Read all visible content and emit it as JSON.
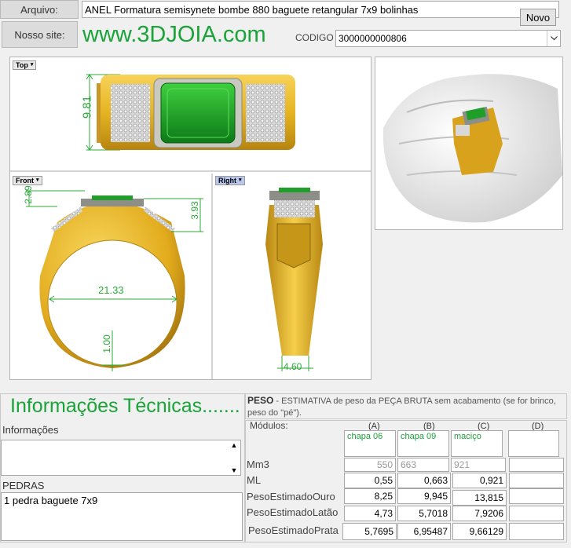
{
  "header": {
    "arquivo_label": "Arquivo:",
    "arquivo_value": "ANEL Formatura semisynete bombe 880 baguete retangular 7x9 bolinhas",
    "novo_button": "Novo",
    "site_label": "Nosso site:",
    "site_url": "www.3DJOIA.com",
    "codigo_label": "CODIGO",
    "codigo_value": "3000000000806"
  },
  "viewports": {
    "top": "Top",
    "front": "Front",
    "right": "Right",
    "dims": {
      "top_width": "9.81",
      "front_height_left": "2.89",
      "front_height_right": "3.93",
      "front_inner": "21.33",
      "front_band": "1.00",
      "right_width": "4.60"
    }
  },
  "info": {
    "title": "Informações Técnicas.......",
    "informacoes_label": "Informações",
    "informacoes_value": "",
    "pedras_label": "PEDRAS",
    "pedras_value": "1 pedra baguete 7x9"
  },
  "peso": {
    "heading_bold": "PESO",
    "heading_rest": "  -  ESTIMATIVA de peso da PEÇA BRUTA sem acabamento (se for brinco, peso do \"pé\").",
    "modulos_label": "Módulos:",
    "columns": [
      "(A)",
      "(B)",
      "(C)",
      "(D)"
    ],
    "types": [
      "chapa 06",
      "chapa 09",
      "maciço",
      ""
    ],
    "rows": [
      {
        "label": "Mm3",
        "values": [
          "550",
          "663",
          "921",
          ""
        ]
      },
      {
        "label": "ML",
        "values": [
          "0,55",
          "0,663",
          "0,921",
          ""
        ]
      },
      {
        "label": "PesoEstimadoOuro",
        "values": [
          "8,25",
          "9,945",
          "13,815",
          ""
        ]
      },
      {
        "label": "PesoEstimadoLatão",
        "values": [
          "4,73",
          "5,7018",
          "7,9206",
          ""
        ]
      },
      {
        "label": "PesoEstimadoPrata",
        "values": [
          "5,7695",
          "6,95487",
          "9,66129",
          ""
        ]
      }
    ]
  },
  "colors": {
    "accent_green": "#1aa339",
    "gold": "#e6b422",
    "gem": "#1f9e2a"
  }
}
